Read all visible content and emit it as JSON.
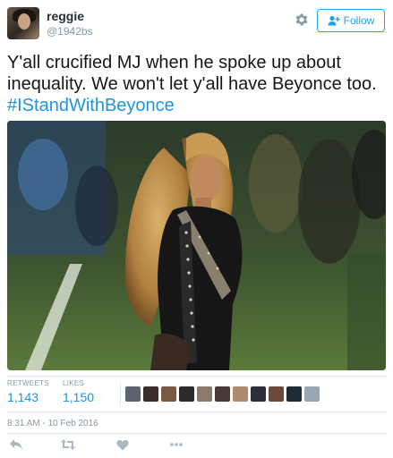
{
  "user": {
    "name": "reggie",
    "handle": "@1942bs"
  },
  "follow_button": {
    "label": "Follow"
  },
  "tweet": {
    "text": "Y'all crucified MJ when he spoke up about inequality. We won't let y'all have Beyonce too.",
    "hashtag": "#IStandWithBeyonce"
  },
  "stats": {
    "retweets_label": "RETWEETS",
    "retweets_count": "1,143",
    "likes_label": "LIKES",
    "likes_count": "1,150"
  },
  "liker_avatars": [
    "#5b6470",
    "#3a2e2a",
    "#7a5a44",
    "#2b2b2b",
    "#8a7a6a",
    "#4a3a36",
    "#b08a70",
    "#2f2f3a",
    "#6a4a3a",
    "#1f2a33",
    "#9aa6b0"
  ],
  "timestamp": "8:31 AM - 10 Feb 2016",
  "colors": {
    "accent": "#1da1f2",
    "link": "#1b95e0",
    "muted": "#8899a6"
  },
  "icons": {
    "settings": "gear-icon",
    "follow": "add-user-icon",
    "reply": "reply-icon",
    "retweet": "retweet-icon",
    "like": "heart-icon",
    "more": "more-icon"
  }
}
